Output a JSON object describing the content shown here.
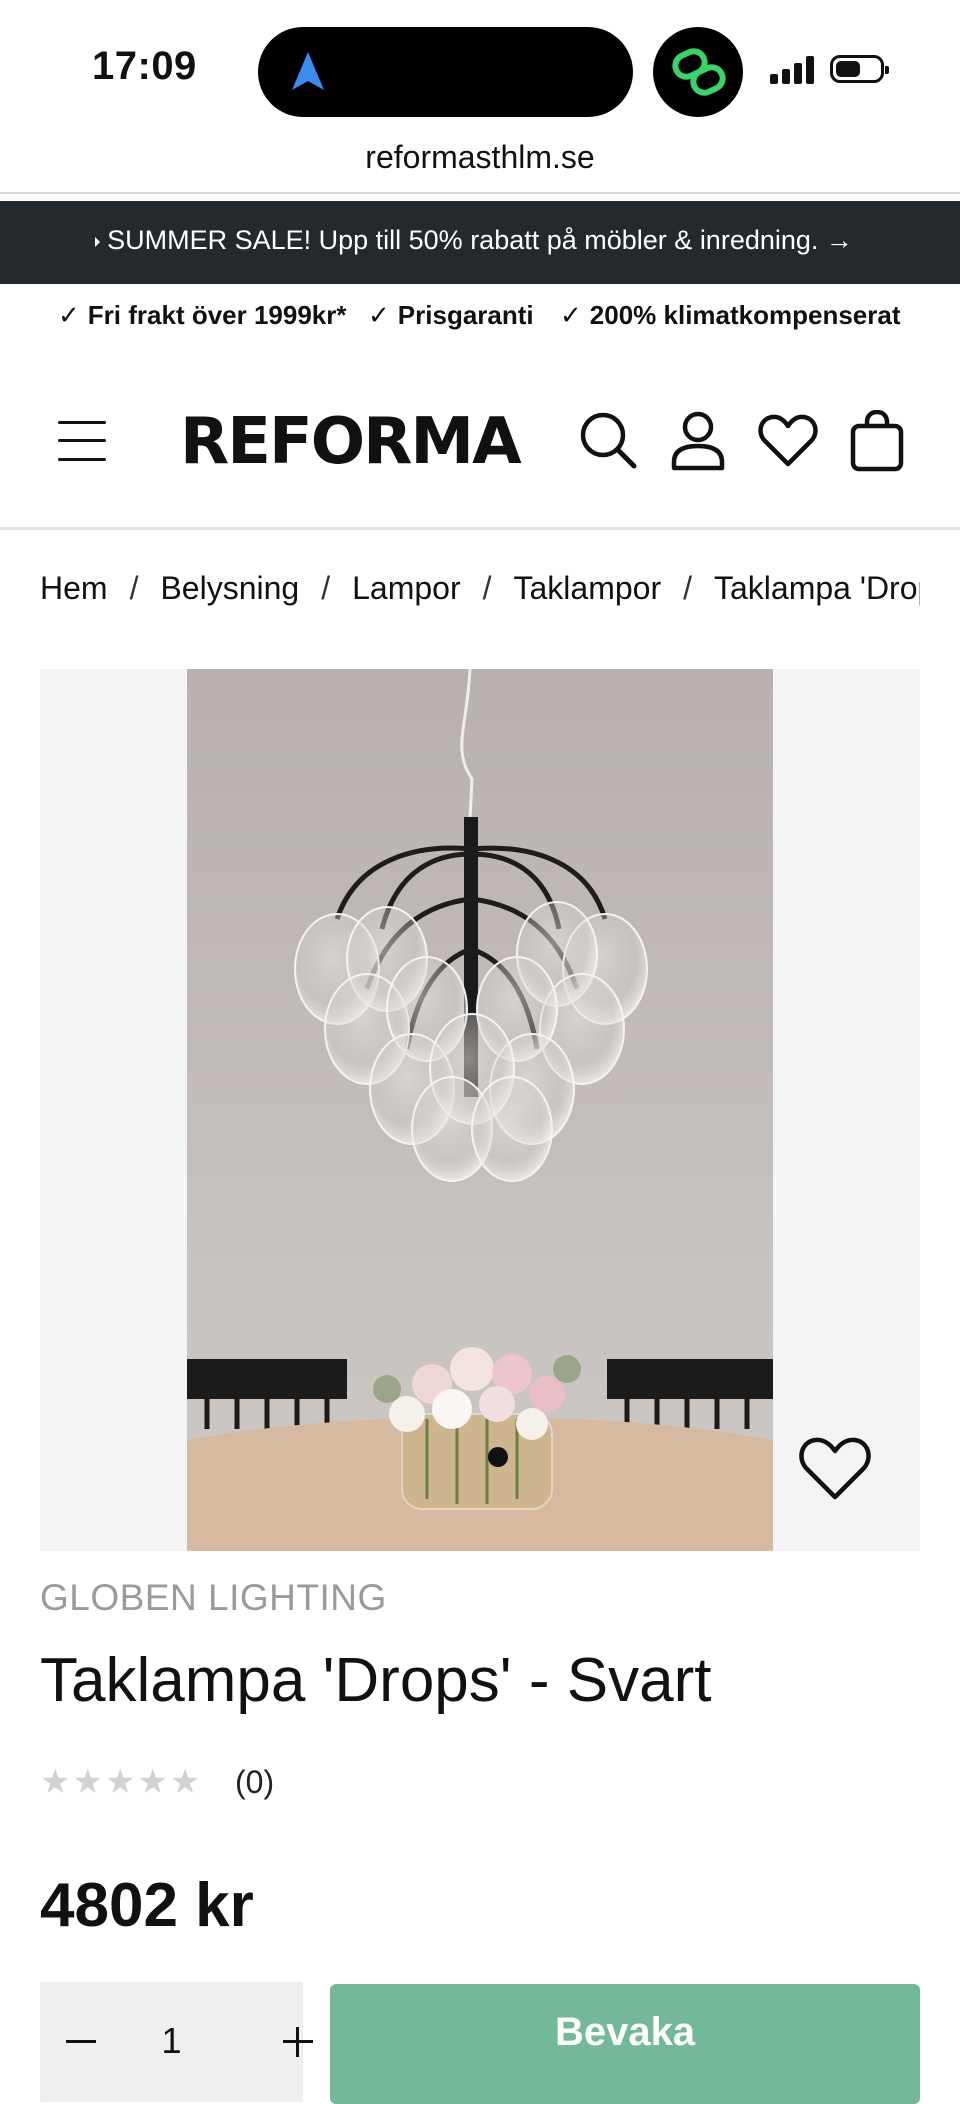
{
  "status_bar": {
    "time": "17:09",
    "url": "reformasthlm.se"
  },
  "promo": {
    "text": "SUMMER SALE! Upp till 50% rabatt på möbler & inredning. →"
  },
  "usps": [
    "Fri frakt över 1999kr*",
    "Prisgaranti",
    "200% klimatkompenserat"
  ],
  "header": {
    "logo": "REFORMA"
  },
  "breadcrumb": [
    "Hem",
    "Belysning",
    "Lampor",
    "Taklampor",
    "Taklampa 'Drops'"
  ],
  "product": {
    "brand": "GLOBEN LIGHTING",
    "title": "Taklampa 'Drops' - Svart",
    "stars": "★★★★★",
    "rating": 0,
    "review_count": "(0)",
    "price": "4802 kr",
    "quantity": "1",
    "cta_label": "Bevaka"
  },
  "colors": {
    "promo_bg": "#23292d",
    "cta": "#72b899",
    "icon_green": "#39d36a",
    "location_blue": "#3b8cf0"
  },
  "icons": [
    "location-arrow-icon",
    "link-icon",
    "signal-icon",
    "battery-icon",
    "menu-icon",
    "search-icon",
    "account-icon",
    "heart-icon",
    "cart-icon",
    "wishlist-icon"
  ]
}
